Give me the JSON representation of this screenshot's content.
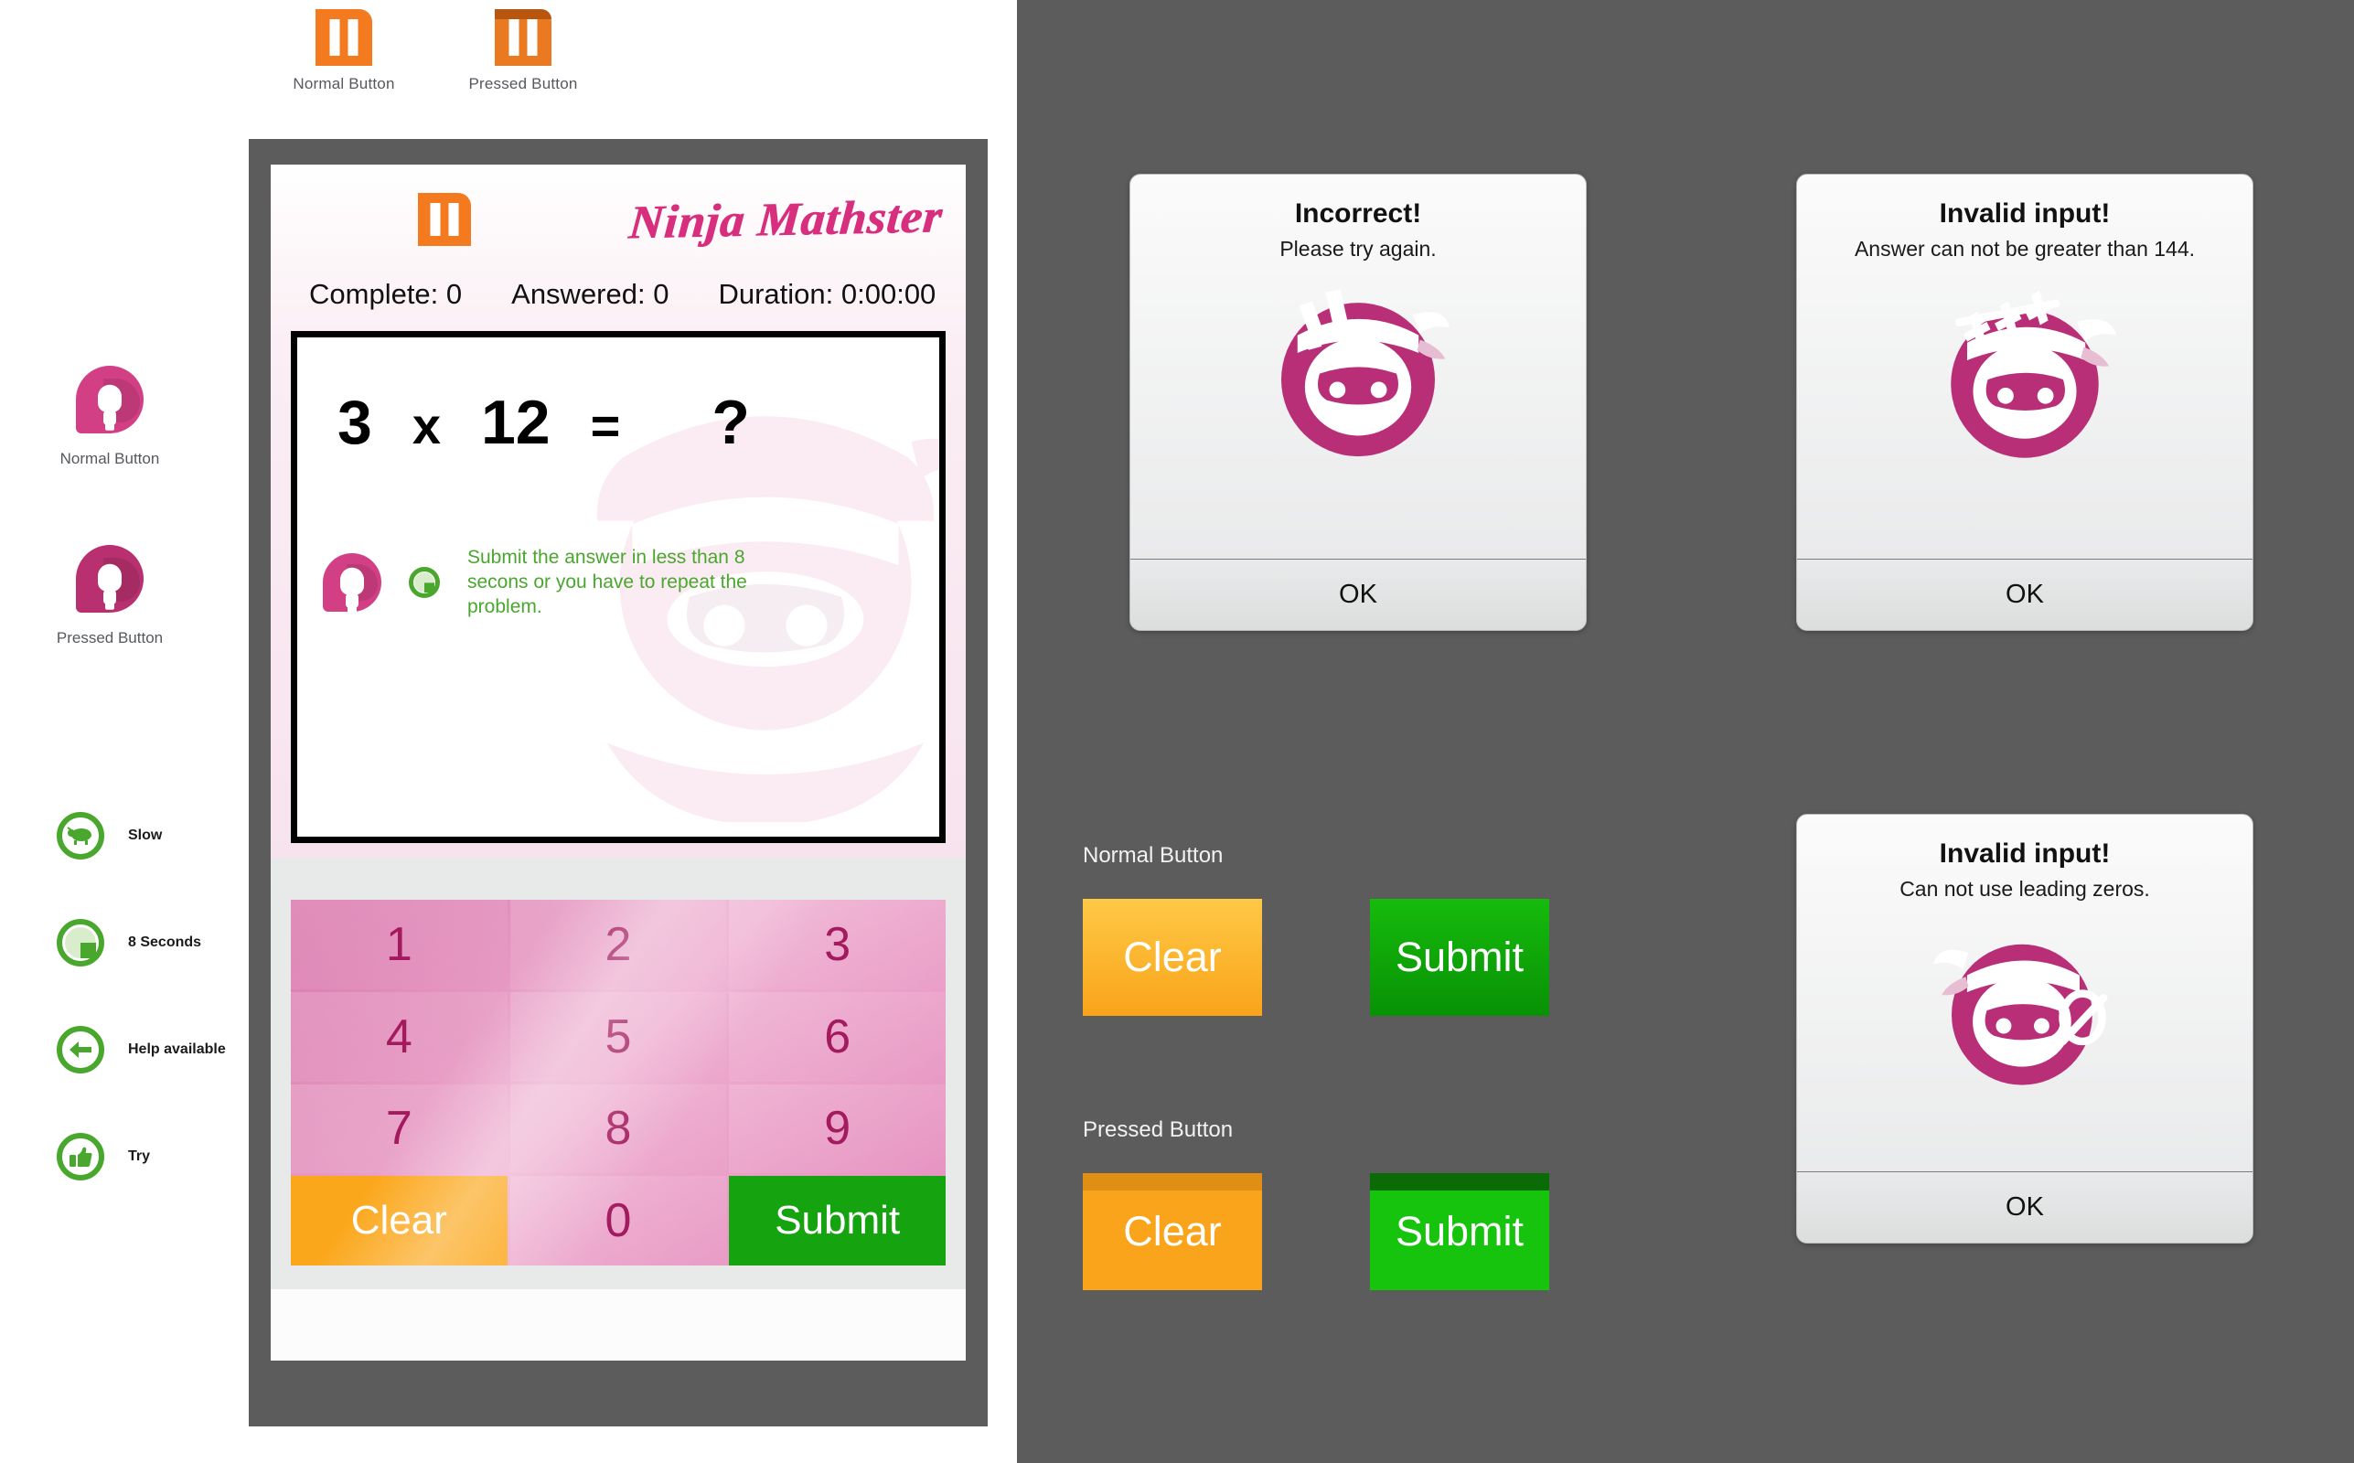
{
  "left_panel": {
    "pause_swatches": [
      {
        "label": "Normal Button",
        "icon": "pause-icon"
      },
      {
        "label": "Pressed Button",
        "icon": "pause-icon-pressed"
      }
    ],
    "hint_swatches": [
      {
        "label": "Normal Button",
        "icon": "lightbulb-hint-icon"
      },
      {
        "label": "Pressed Button",
        "icon": "lightbulb-hint-icon-pressed"
      }
    ],
    "legend": [
      {
        "label": "Slow",
        "icon": "turtle-icon"
      },
      {
        "label": "8 Seconds",
        "icon": "pie-timer-icon"
      },
      {
        "label": "Help available",
        "icon": "left-arrow-icon"
      },
      {
        "label": "Try",
        "icon": "thumbs-up-icon"
      }
    ]
  },
  "app": {
    "title": "Ninja Mathster",
    "pause_icon": "pause-icon",
    "stats": [
      "Complete: 0",
      "Answered: 0",
      "Duration: 0:00:00"
    ],
    "problem": {
      "operand_a": "3",
      "operator": "x",
      "operand_b": "12",
      "equals": "=",
      "answer_placeholder": "?"
    },
    "hint": {
      "bulb_icon": "lightbulb-hint-icon",
      "timer_icon": "pie-timer-icon",
      "text": "Submit the answer in less than 8 secons or you have to repeat the problem."
    },
    "keypad": {
      "digits": [
        "1",
        "2",
        "3",
        "4",
        "5",
        "6",
        "7",
        "8",
        "9"
      ],
      "zero": "0",
      "clear_label": "Clear",
      "submit_label": "Submit"
    }
  },
  "dialogs": [
    {
      "title": "Incorrect!",
      "message": "Please try again.",
      "art": "ninja-surprised-icon",
      "ok_label": "OK"
    },
    {
      "title": "Invalid input!",
      "message": "Answer can not be greater than 144.",
      "art": "ninja-144-crossed-icon",
      "ok_label": "OK"
    },
    {
      "title": "Invalid input!",
      "message": "Can not use leading zeros.",
      "art": "ninja-zero-crossed-icon",
      "ok_label": "OK"
    }
  ],
  "button_states": {
    "normal_label": "Normal Button",
    "pressed_label": "Pressed Button",
    "clear_label": "Clear",
    "submit_label": "Submit"
  },
  "colors": {
    "brand_pink": "#d72f7e",
    "ninja_magenta": "#b92f77",
    "orange_pause": "#f47a20",
    "clear_amber": "#f9a41a",
    "submit_green": "#16a310",
    "legend_green": "#4aa72e",
    "panel_gray": "#5c5c5c",
    "keypad_pink": "#e58fbe"
  }
}
